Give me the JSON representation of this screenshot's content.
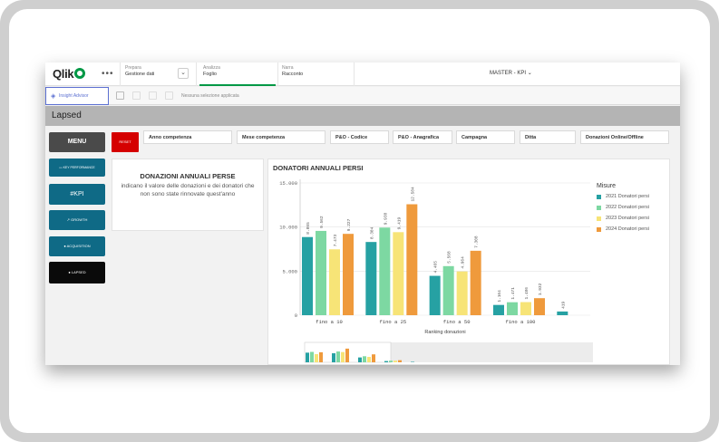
{
  "topbar": {
    "logo_text": "Qlik",
    "menu_dots": "•••",
    "prepare": {
      "label": "Prepara",
      "value": "Gestione dati"
    },
    "analyze": {
      "label": "Analizza",
      "value": "Foglio"
    },
    "narrate": {
      "label": "Narra",
      "value": "Racconto"
    },
    "app_name": "MASTER - KPI"
  },
  "toolbar": {
    "insight_advisor": "Insight Advisor",
    "no_selection": "Nessuna selezione applicata"
  },
  "sheet_title": "Lapsed",
  "left_nav": {
    "menu": "MENU",
    "items": [
      {
        "label": "KEY PERFORMANCE",
        "icon": "kpi-dashboard-icon"
      },
      {
        "label": "KPI",
        "icon": "hashtag-icon"
      },
      {
        "label": "GROWTH",
        "icon": "trend-icon"
      },
      {
        "label": "ACQUISITION",
        "icon": "plus-circle-icon"
      },
      {
        "label": "LAPSED",
        "icon": "user-icon",
        "active": true
      }
    ]
  },
  "filters": {
    "reset": "RESET",
    "items": [
      "Anno competenza",
      "Mese competenza",
      "P&O - Codice",
      "P&O - Anagrafica",
      "Campagna",
      "Ditta",
      "Donazioni Online/Offline"
    ]
  },
  "text_panel": {
    "title": "DONAZIONI ANNUALI PERSE",
    "body": "indicano il valore delle donazioni e dei donatori che non sono state rinnovate quest'anno"
  },
  "chart": {
    "title": "DONATORI ANNUALI PERSI",
    "legend_title": "Misure"
  },
  "colors": {
    "brand_green": "#009845",
    "nav_teal": "#0f6a86",
    "reset_red": "#d50000",
    "series": [
      "#26a1a3",
      "#7dd8a2",
      "#f7e477",
      "#ef9a3c"
    ]
  },
  "chart_data": {
    "type": "bar",
    "title": "DONATORI ANNUALI PERSI",
    "xlabel": "Ranking donazioni",
    "ylabel": "",
    "ylim": [
      0,
      15000
    ],
    "yticks": [
      "0",
      "5.000",
      "10.000",
      "15.000"
    ],
    "categories": [
      "fino a   10",
      "fino a   25",
      "fino a   50",
      "fino a  100",
      ""
    ],
    "series": [
      {
        "name": "2021 Donatori persi",
        "values": [
          8865,
          8304,
          4465,
          1164,
          419
        ],
        "labels": [
          "8.865",
          "8.304",
          "4.465",
          "1.164",
          "419"
        ]
      },
      {
        "name": "2022 Donatori persi",
        "values": [
          9562,
          9938,
          5568,
          1471,
          null
        ],
        "labels": [
          "9.562",
          "9.938",
          "5.568",
          "1.471",
          ""
        ]
      },
      {
        "name": "2023 Donatori persi",
        "values": [
          7473,
          9419,
          4964,
          1486,
          null
        ],
        "labels": [
          "7.473",
          "9.419",
          "4.964",
          "1.486",
          ""
        ]
      },
      {
        "name": "2024 Donatori persi",
        "values": [
          9227,
          12584,
          7308,
          1932,
          null
        ],
        "labels": [
          "9.227",
          "12.584",
          "7.308",
          "1.932",
          ""
        ]
      }
    ],
    "legend": "right",
    "grid": true
  }
}
